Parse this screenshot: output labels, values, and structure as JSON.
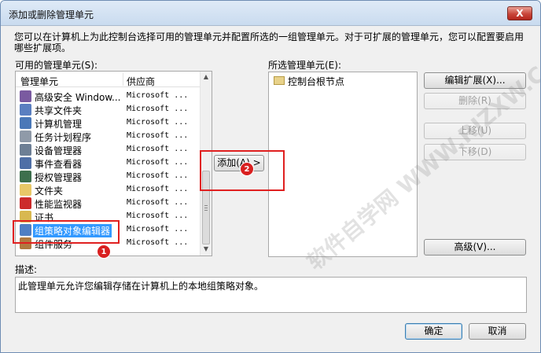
{
  "window": {
    "title": "添加或删除管理单元",
    "close_label": "X"
  },
  "intro": "您可以在计算机上为此控制台选择可用的管理单元并配置所选的一组管理单元。对于可扩展的管理单元，您可以配置要启用哪些扩展项。",
  "available": {
    "label": "可用的管理单元(S):",
    "col_name": "管理单元",
    "col_vendor": "供应商",
    "items": [
      {
        "name": "高级安全 Window...",
        "vendor": "Microsoft ...",
        "icon": "shield-globe-icon",
        "color": "#7a5aa0"
      },
      {
        "name": "共享文件夹",
        "vendor": "Microsoft ...",
        "icon": "shared-folder-icon",
        "color": "#5a7fc0"
      },
      {
        "name": "计算机管理",
        "vendor": "Microsoft ...",
        "icon": "computer-management-icon",
        "color": "#4a78b8"
      },
      {
        "name": "任务计划程序",
        "vendor": "Microsoft ...",
        "icon": "clock-icon",
        "color": "#8f9aa8"
      },
      {
        "name": "设备管理器",
        "vendor": "Microsoft ...",
        "icon": "device-manager-icon",
        "color": "#6d7f95"
      },
      {
        "name": "事件查看器",
        "vendor": "Microsoft ...",
        "icon": "event-viewer-icon",
        "color": "#4f6fa6"
      },
      {
        "name": "授权管理器",
        "vendor": "Microsoft ...",
        "icon": "authorization-icon",
        "color": "#3d6f4d"
      },
      {
        "name": "文件夹",
        "vendor": "Microsoft ...",
        "icon": "folder-icon",
        "color": "#e8c868"
      },
      {
        "name": "性能监视器",
        "vendor": "Microsoft ...",
        "icon": "no-entry-icon",
        "color": "#cc2b2b"
      },
      {
        "name": "证书",
        "vendor": "Microsoft ...",
        "icon": "certificate-icon",
        "color": "#d8b850"
      },
      {
        "name": "组策略对象编辑器",
        "vendor": "Microsoft ...",
        "icon": "group-policy-icon",
        "color": "#4f7fc4",
        "selected": true
      },
      {
        "name": "组件服务",
        "vendor": "Microsoft ...",
        "icon": "component-services-icon",
        "color": "#b07a40"
      }
    ]
  },
  "middle": {
    "add_label": "添加(A) >"
  },
  "selected": {
    "label": "所选管理单元(E):",
    "root": "控制台根节点"
  },
  "side_buttons": {
    "edit_ext": "编辑扩展(X)...",
    "remove": "删除(R)",
    "move_up": "上移(U)",
    "move_down": "下移(D)",
    "advanced": "高级(V)..."
  },
  "description": {
    "label": "描述:",
    "text": "此管理单元允许您编辑存储在计算机上的本地组策略对象。"
  },
  "footer": {
    "ok": "确定",
    "cancel": "取消"
  },
  "annotations": {
    "badge1": "1",
    "badge2": "2"
  },
  "watermark": "软件自学网 WWW.RJZXW.COM"
}
